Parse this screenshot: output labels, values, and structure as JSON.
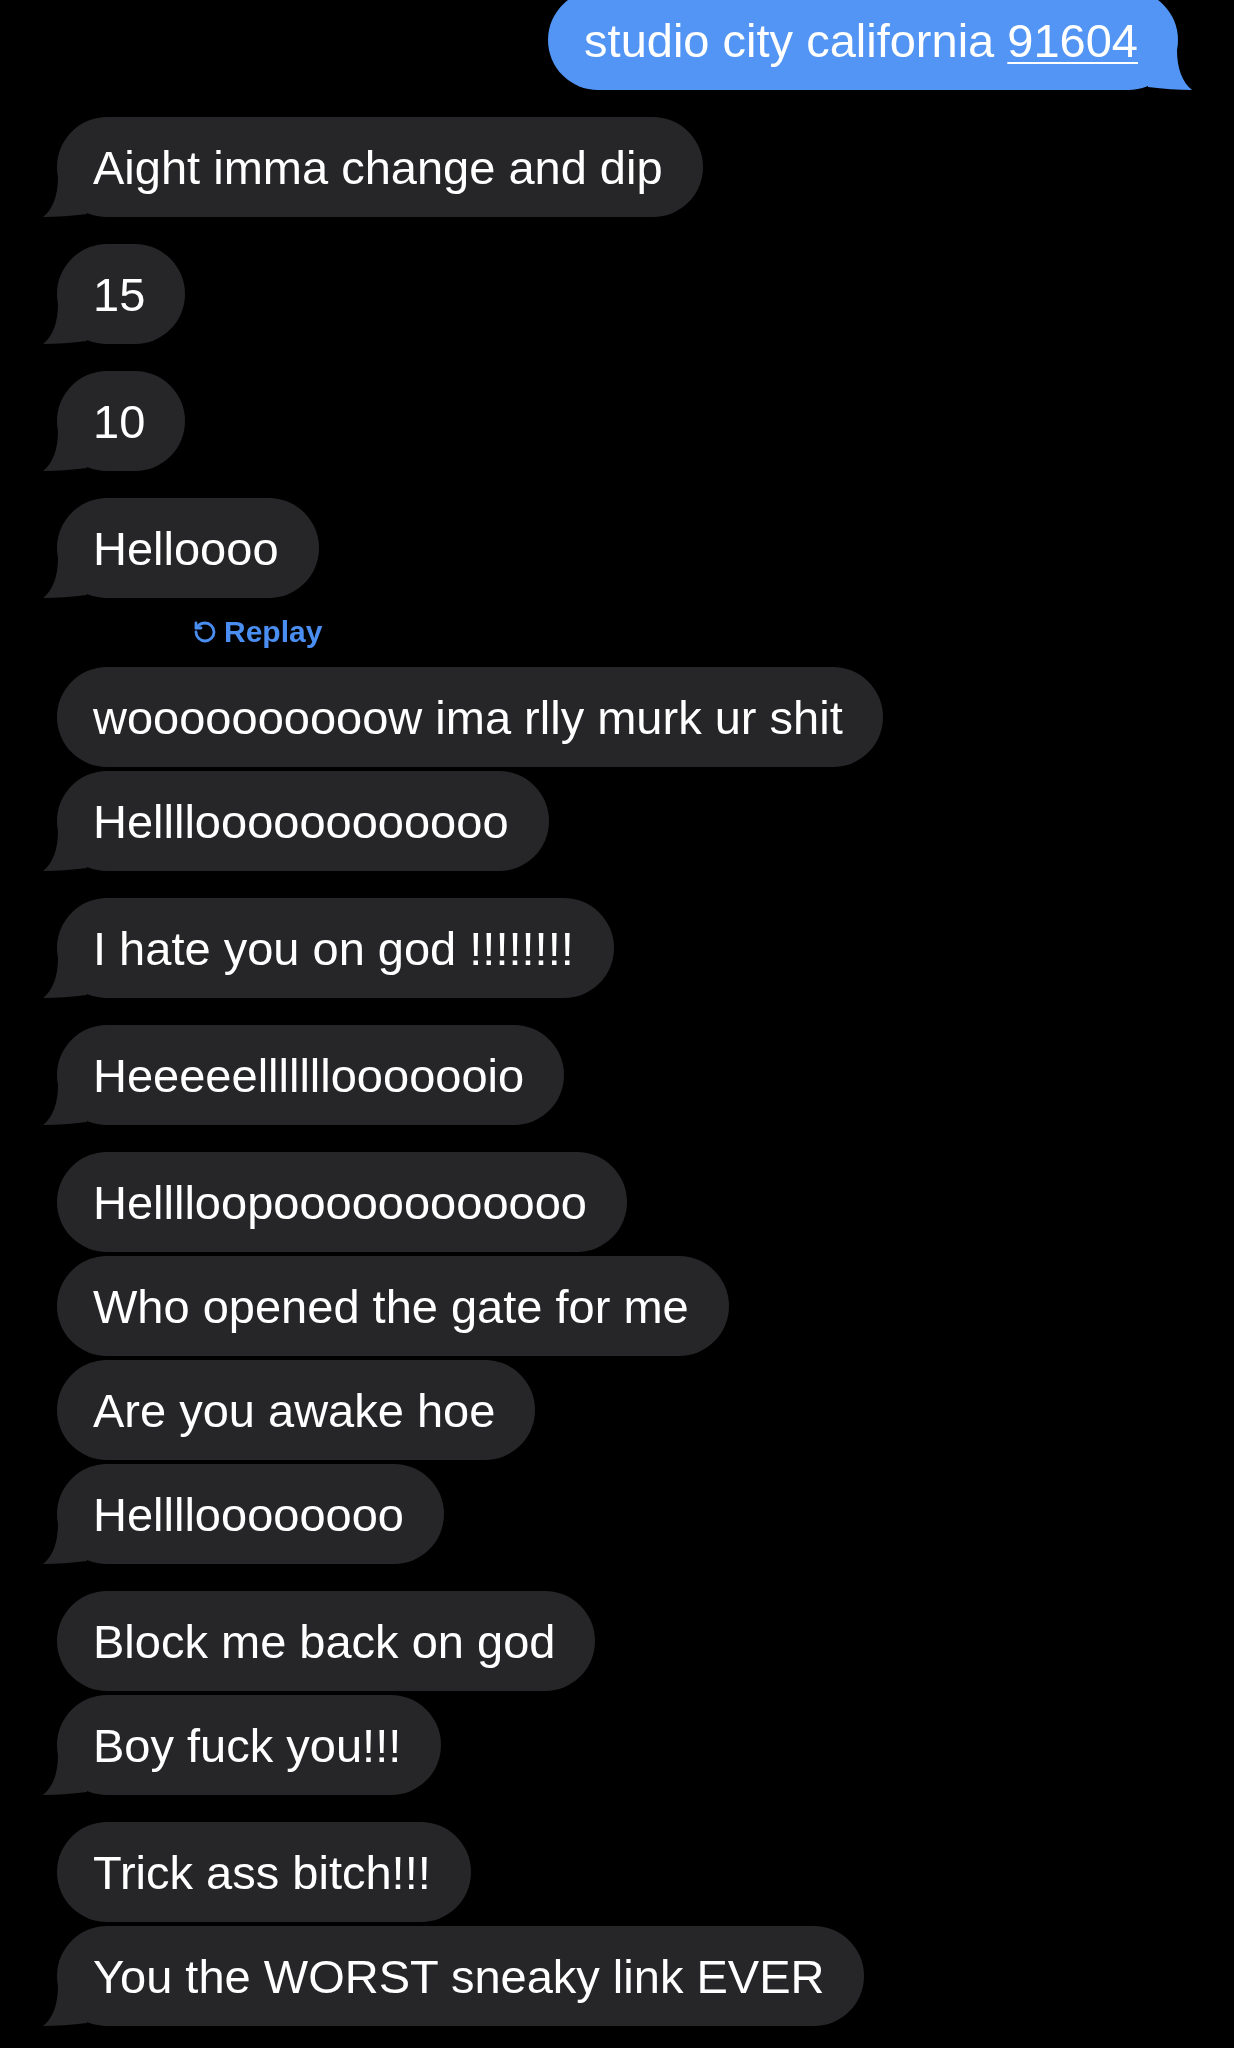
{
  "messages": [
    {
      "kind": "sent",
      "text": "studio city california",
      "link": "91604",
      "tail": true
    },
    {
      "kind": "received",
      "text": "Aight imma change and dip",
      "tail": true
    },
    {
      "kind": "received",
      "text": "15",
      "tail": true
    },
    {
      "kind": "received",
      "text": "10",
      "tail": true
    },
    {
      "kind": "received",
      "text": "Helloooo",
      "tail": true
    },
    {
      "kind": "replay",
      "label": "Replay"
    },
    {
      "kind": "received",
      "text": "woooooooooow ima rlly murk ur shit",
      "tail": false
    },
    {
      "kind": "received",
      "text": "Helllloooooooooooo",
      "tail": true
    },
    {
      "kind": "received",
      "text": "I hate you on god !!!!!!!!",
      "tail": true
    },
    {
      "kind": "received",
      "text": "Heeeeelllllllooooooio",
      "tail": true
    },
    {
      "kind": "received",
      "text": "Helllloopoooooooooooo",
      "tail": false
    },
    {
      "kind": "received",
      "text": "Who opened the gate for me",
      "tail": false
    },
    {
      "kind": "received",
      "text": "Are you awake hoe",
      "tail": false
    },
    {
      "kind": "received",
      "text": "Helllloooooooo",
      "tail": true
    },
    {
      "kind": "received",
      "text": "Block me back on god",
      "tail": false
    },
    {
      "kind": "received",
      "text": "Boy fuck you!!!",
      "tail": true
    },
    {
      "kind": "received",
      "text": "Trick ass bitch!!!",
      "tail": false
    },
    {
      "kind": "received",
      "text": "You the WORST sneaky link EVER",
      "tail": true
    }
  ]
}
